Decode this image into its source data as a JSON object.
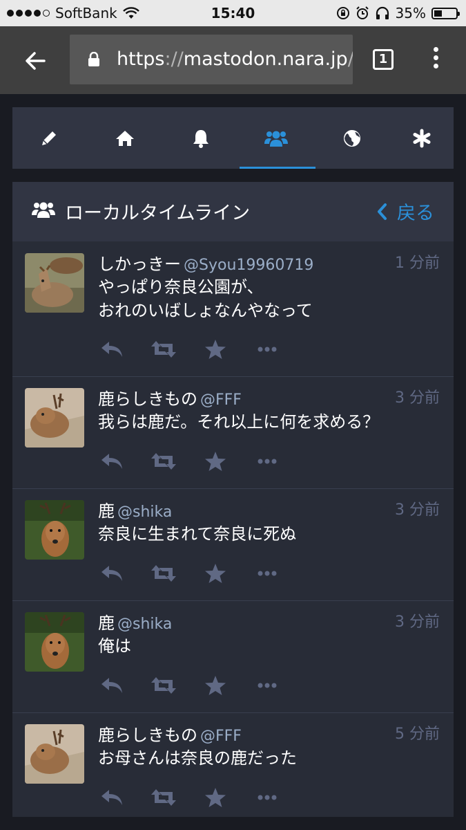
{
  "statusbar": {
    "carrier": "SoftBank",
    "time": "15:40",
    "battery": "35%",
    "battery_level": 0.35
  },
  "browser": {
    "url_protocol": "https",
    "url_separator": "://",
    "url_host": "mastodon.nara.jp",
    "url_path": "/",
    "tab_count": "1"
  },
  "nav": {
    "active": "local",
    "tabs": [
      {
        "id": "compose",
        "icon": "pencil-icon"
      },
      {
        "id": "home",
        "icon": "home-icon"
      },
      {
        "id": "notifications",
        "icon": "bell-icon"
      },
      {
        "id": "local",
        "icon": "users-icon"
      },
      {
        "id": "federated",
        "icon": "globe-icon"
      },
      {
        "id": "getting-started",
        "icon": "asterisk-icon"
      }
    ]
  },
  "column": {
    "title": "ローカルタイムライン",
    "back_label": "戻る"
  },
  "statuses": [
    {
      "display_name": "しかっきー",
      "acct": "@Syou19960719",
      "time": "1 分前",
      "lines": [
        "やっぱり奈良公園が、",
        "おれのいばしょなんやなって"
      ]
    },
    {
      "display_name": "鹿らしきもの",
      "acct": "@FFF",
      "time": "3 分前",
      "lines": [
        "我らは鹿だ。それ以上に何を求める？"
      ]
    },
    {
      "display_name": "鹿",
      "acct": "@shika",
      "time": "3 分前",
      "lines": [
        "奈良に生まれて奈良に死ぬ"
      ]
    },
    {
      "display_name": "鹿",
      "acct": "@shika",
      "time": "3 分前",
      "lines": [
        "俺は"
      ]
    },
    {
      "display_name": "鹿らしきもの",
      "acct": "@FFF",
      "time": "5 分前",
      "lines": [
        "お母さんは奈良の鹿だった"
      ]
    }
  ],
  "colors": {
    "accent": "#2b90d9",
    "action_icon": "#606984"
  }
}
